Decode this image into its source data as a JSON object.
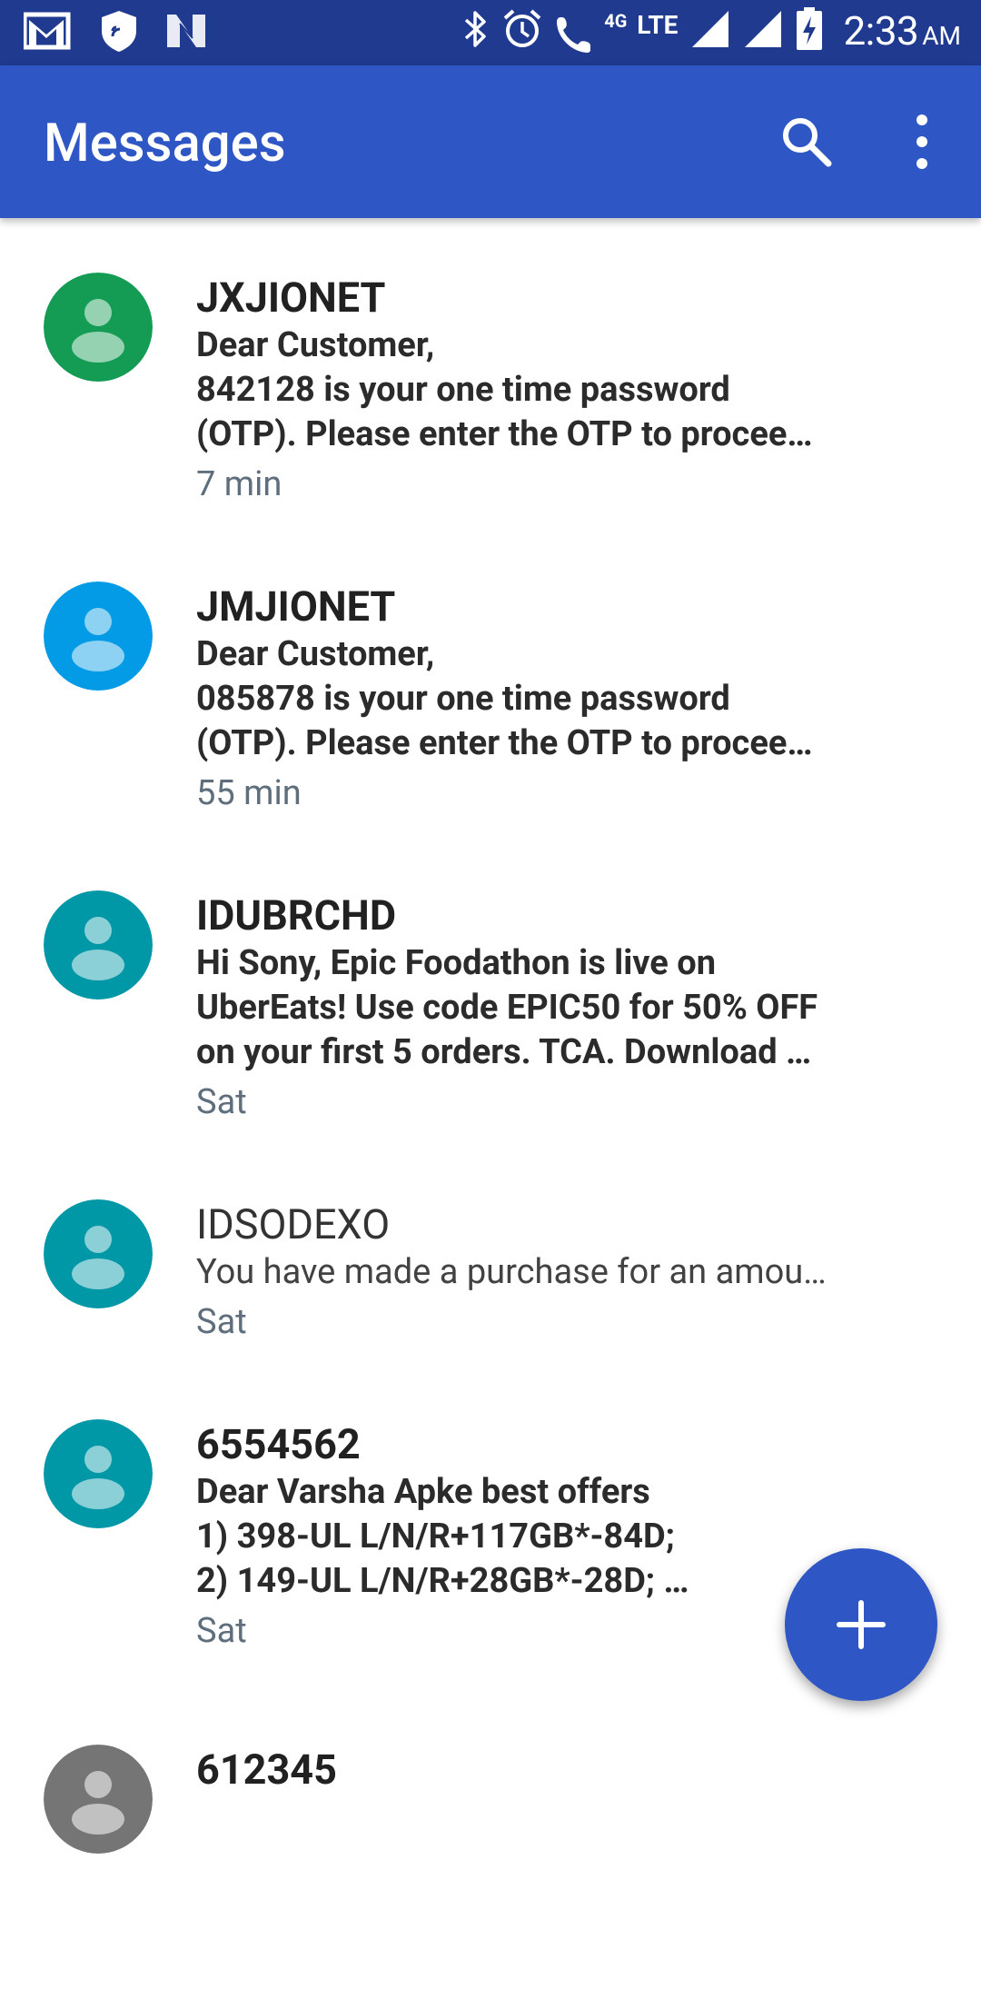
{
  "status_bar": {
    "time": "2:33",
    "ampm": "AM",
    "network": "LTE",
    "call_label": "4G",
    "left_icons": [
      "gmail-icon",
      "shield-icon",
      "n-app-icon"
    ],
    "right_icons": [
      "bluetooth-icon",
      "alarm-icon",
      "wifi-calling-icon",
      "signal-icon",
      "signal-icon",
      "battery-charging-icon"
    ]
  },
  "app_bar": {
    "title": "Messages",
    "icons": [
      "search-icon",
      "more-vert-icon"
    ]
  },
  "conversations": [
    {
      "name": "JXJIONET",
      "snippet_lines": [
        "Dear Customer,",
        "842128 is your one time password",
        "(OTP). Please enter the OTP to procee…"
      ],
      "time": "7 min",
      "unread": true,
      "avatar_color": "#149c55"
    },
    {
      "name": "JMJIONET",
      "snippet_lines": [
        "Dear Customer,",
        "085878 is your one time password",
        "(OTP). Please enter the OTP to procee…"
      ],
      "time": "55 min",
      "unread": true,
      "avatar_color": "#039be5"
    },
    {
      "name": "IDUBRCHD",
      "snippet_lines": [
        "Hi Sony, Epic Foodathon is live on",
        "UberEats! Use code EPIC50 for 50% OFF",
        "on your first 5 orders. TCA. Download …"
      ],
      "time": "Sat",
      "unread": true,
      "avatar_color": "#0097a7"
    },
    {
      "name": "IDSODEXO",
      "snippet_lines": [
        "You have made a purchase for an amou…"
      ],
      "time": "Sat",
      "unread": false,
      "avatar_color": "#0097a7"
    },
    {
      "name": "6554562",
      "snippet_lines": [
        "Dear Varsha Apke best offers",
        "1) 398-UL L/N/R+117GB*-84D;",
        "2) 149-UL L/N/R+28GB*-28D; …"
      ],
      "time": "Sat",
      "unread": true,
      "avatar_color": "#0097a7"
    },
    {
      "name": "612345",
      "snippet_lines": [],
      "time": "",
      "unread": true,
      "avatar_color": "#757575"
    }
  ],
  "fab": {
    "icon": "plus-icon"
  }
}
